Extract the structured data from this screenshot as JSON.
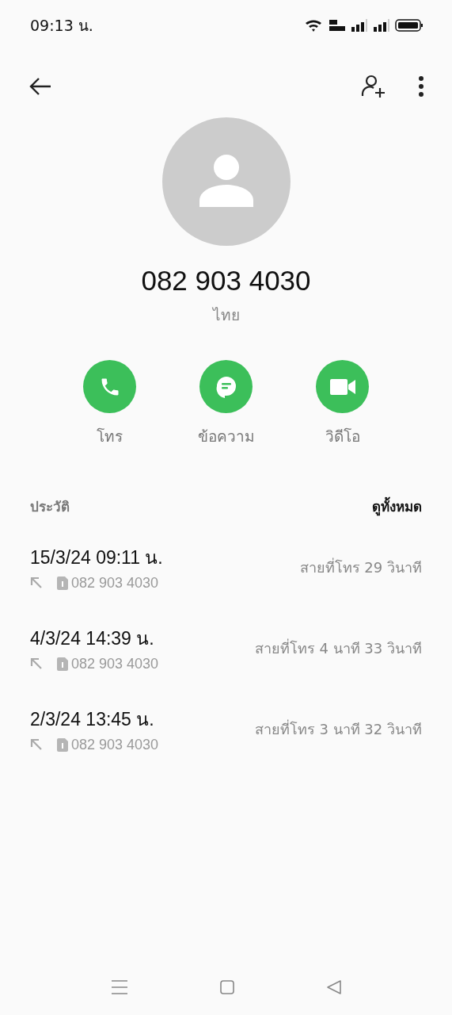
{
  "status_bar": {
    "time": "09:13 น."
  },
  "contact": {
    "number": "082 903 4030",
    "region": "ไทย"
  },
  "actions": [
    {
      "kind": "call",
      "label": "โทร"
    },
    {
      "kind": "message",
      "label": "ข้อความ"
    },
    {
      "kind": "video",
      "label": "วิดีโอ"
    }
  ],
  "history": {
    "title": "ประวัติ",
    "view_all": "ดูทั้งหมด",
    "entries": [
      {
        "kind": "outgoing",
        "datetime": "15/3/24 09:11 น.",
        "number": "082 903 4030",
        "duration": "สายที่โทร  29 วินาที"
      },
      {
        "kind": "outgoing",
        "datetime": "4/3/24 14:39 น.",
        "number": "082 903 4030",
        "duration": "สายที่โทร  4 นาที 33 วินาที"
      },
      {
        "kind": "outgoing",
        "datetime": "2/3/24 13:45 น.",
        "number": "082 903 4030",
        "duration": "สายที่โทร  3 นาที 32 วินาที"
      }
    ]
  }
}
